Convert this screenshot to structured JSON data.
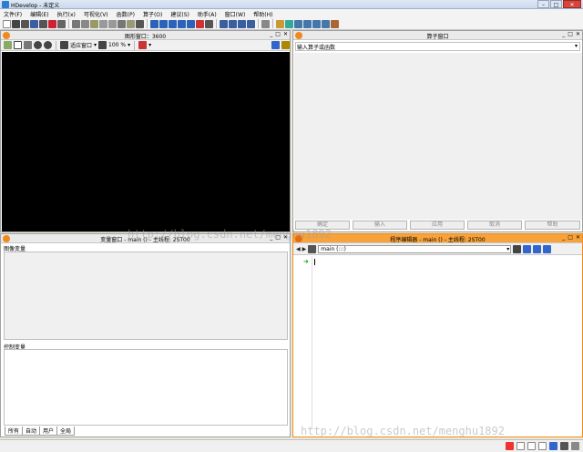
{
  "app": {
    "title": "HDevelop - 未定义"
  },
  "menu": [
    "文件(F)",
    "编辑(E)",
    "执行(x)",
    "可视化(V)",
    "函数(P)",
    "算子(O)",
    "建议(S)",
    "助手(A)",
    "窗口(W)",
    "帮助(H)"
  ],
  "graphics": {
    "title": "图形窗口：3600",
    "fit_label": "适应窗口",
    "zoom": "100 %"
  },
  "operator": {
    "title": "算子窗口",
    "input_placeholder": "输入算子或函数",
    "buttons": [
      "确定",
      "输入",
      "应用",
      "取消",
      "帮助"
    ]
  },
  "variables": {
    "title": "变量窗口 - main () - 主线程: 2ST00",
    "image_vars": "图像变量",
    "control_vars": "控制变量",
    "tabs": [
      "所有",
      "自动",
      "用户",
      "全局"
    ]
  },
  "program": {
    "title": "程序编辑器 - main () - 主线程: 2ST00",
    "proc_select": "main (:::)"
  },
  "watermark": "http://blog.csdn.net/menghu1892",
  "colors": {
    "accent": "#f08a1c",
    "canvas": "#000000",
    "program_title": "#f7a23a"
  }
}
